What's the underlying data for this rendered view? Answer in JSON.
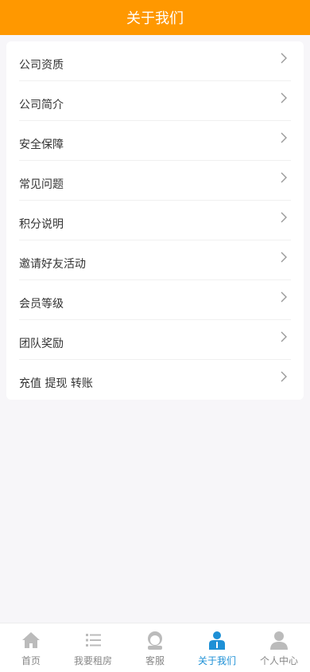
{
  "header": {
    "title": "关于我们"
  },
  "menu": {
    "items": [
      {
        "label": "公司资质"
      },
      {
        "label": "公司简介"
      },
      {
        "label": "安全保障"
      },
      {
        "label": "常见问题"
      },
      {
        "label": "积分说明"
      },
      {
        "label": "邀请好友活动"
      },
      {
        "label": "会员等级"
      },
      {
        "label": "团队奖励"
      },
      {
        "label": "充值 提现 转账"
      }
    ]
  },
  "tabbar": {
    "items": [
      {
        "label": "首页",
        "icon": "home-icon"
      },
      {
        "label": "我要租房",
        "icon": "list-icon"
      },
      {
        "label": "客服",
        "icon": "service-icon"
      },
      {
        "label": "关于我们",
        "icon": "about-icon",
        "active": true
      },
      {
        "label": "个人中心",
        "icon": "user-icon"
      }
    ]
  },
  "colors": {
    "header_bg": "#ff9800",
    "active_tab": "#1e90d6",
    "inactive_tab": "#bbbbbb"
  }
}
